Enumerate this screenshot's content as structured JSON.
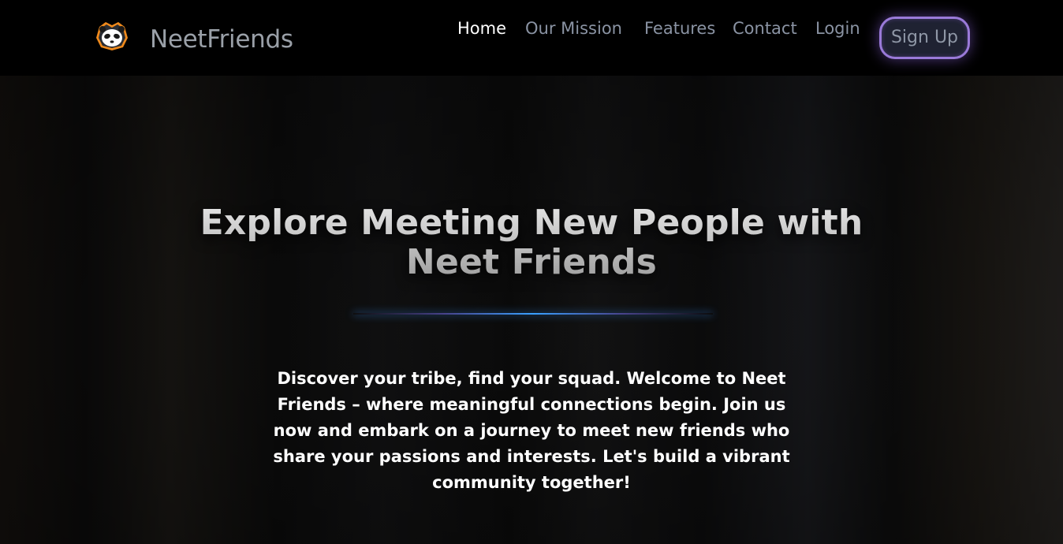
{
  "navbar": {
    "logo_icon": "panda-ninja-icon",
    "brand": "NeetFriends",
    "links": [
      {
        "label": "Home",
        "active": true
      },
      {
        "label": "Our Mission",
        "active": false
      },
      {
        "label": "Features",
        "active": false
      },
      {
        "label": "Contact",
        "active": false
      },
      {
        "label": "Login",
        "active": false
      }
    ],
    "signup_label": "Sign Up"
  },
  "hero": {
    "title_line1": "Explore Meeting New People with",
    "title_line2": "Neet Friends",
    "text": "Discover your tribe, find your squad. Welcome to Neet Friends – where meaningful connections begin. Join us now and embark on a journey to meet new friends who share your passions and interests. Let's build a vibrant community together!"
  },
  "colors": {
    "accent_border": "#9a7ad8",
    "divider_glow": "#3aa0ff",
    "nav_text": "#8a93a3",
    "nav_active": "#ffffff"
  }
}
